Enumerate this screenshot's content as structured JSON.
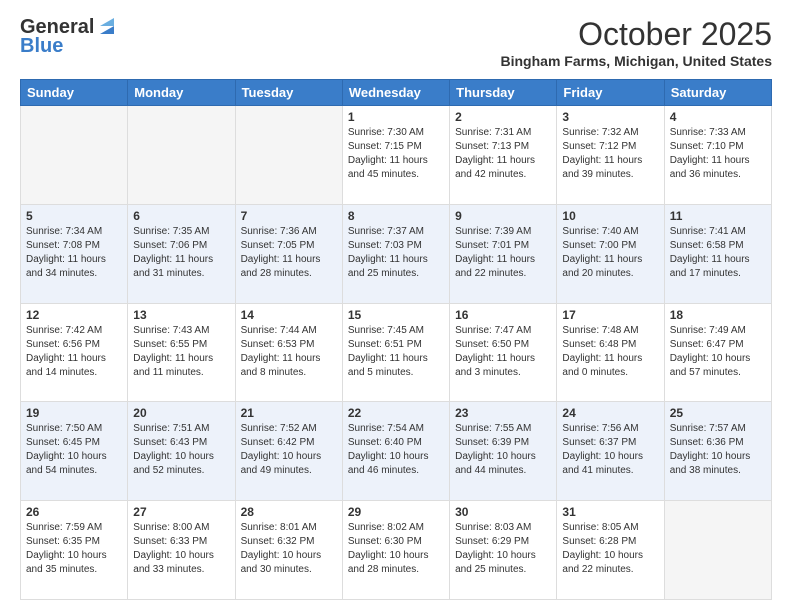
{
  "header": {
    "logo_line1": "General",
    "logo_line2": "Blue",
    "month": "October 2025",
    "location": "Bingham Farms, Michigan, United States"
  },
  "days_of_week": [
    "Sunday",
    "Monday",
    "Tuesday",
    "Wednesday",
    "Thursday",
    "Friday",
    "Saturday"
  ],
  "weeks": [
    [
      {
        "day": "",
        "info": ""
      },
      {
        "day": "",
        "info": ""
      },
      {
        "day": "",
        "info": ""
      },
      {
        "day": "1",
        "info": "Sunrise: 7:30 AM\nSunset: 7:15 PM\nDaylight: 11 hours\nand 45 minutes."
      },
      {
        "day": "2",
        "info": "Sunrise: 7:31 AM\nSunset: 7:13 PM\nDaylight: 11 hours\nand 42 minutes."
      },
      {
        "day": "3",
        "info": "Sunrise: 7:32 AM\nSunset: 7:12 PM\nDaylight: 11 hours\nand 39 minutes."
      },
      {
        "day": "4",
        "info": "Sunrise: 7:33 AM\nSunset: 7:10 PM\nDaylight: 11 hours\nand 36 minutes."
      }
    ],
    [
      {
        "day": "5",
        "info": "Sunrise: 7:34 AM\nSunset: 7:08 PM\nDaylight: 11 hours\nand 34 minutes."
      },
      {
        "day": "6",
        "info": "Sunrise: 7:35 AM\nSunset: 7:06 PM\nDaylight: 11 hours\nand 31 minutes."
      },
      {
        "day": "7",
        "info": "Sunrise: 7:36 AM\nSunset: 7:05 PM\nDaylight: 11 hours\nand 28 minutes."
      },
      {
        "day": "8",
        "info": "Sunrise: 7:37 AM\nSunset: 7:03 PM\nDaylight: 11 hours\nand 25 minutes."
      },
      {
        "day": "9",
        "info": "Sunrise: 7:39 AM\nSunset: 7:01 PM\nDaylight: 11 hours\nand 22 minutes."
      },
      {
        "day": "10",
        "info": "Sunrise: 7:40 AM\nSunset: 7:00 PM\nDaylight: 11 hours\nand 20 minutes."
      },
      {
        "day": "11",
        "info": "Sunrise: 7:41 AM\nSunset: 6:58 PM\nDaylight: 11 hours\nand 17 minutes."
      }
    ],
    [
      {
        "day": "12",
        "info": "Sunrise: 7:42 AM\nSunset: 6:56 PM\nDaylight: 11 hours\nand 14 minutes."
      },
      {
        "day": "13",
        "info": "Sunrise: 7:43 AM\nSunset: 6:55 PM\nDaylight: 11 hours\nand 11 minutes."
      },
      {
        "day": "14",
        "info": "Sunrise: 7:44 AM\nSunset: 6:53 PM\nDaylight: 11 hours\nand 8 minutes."
      },
      {
        "day": "15",
        "info": "Sunrise: 7:45 AM\nSunset: 6:51 PM\nDaylight: 11 hours\nand 5 minutes."
      },
      {
        "day": "16",
        "info": "Sunrise: 7:47 AM\nSunset: 6:50 PM\nDaylight: 11 hours\nand 3 minutes."
      },
      {
        "day": "17",
        "info": "Sunrise: 7:48 AM\nSunset: 6:48 PM\nDaylight: 11 hours\nand 0 minutes."
      },
      {
        "day": "18",
        "info": "Sunrise: 7:49 AM\nSunset: 6:47 PM\nDaylight: 10 hours\nand 57 minutes."
      }
    ],
    [
      {
        "day": "19",
        "info": "Sunrise: 7:50 AM\nSunset: 6:45 PM\nDaylight: 10 hours\nand 54 minutes."
      },
      {
        "day": "20",
        "info": "Sunrise: 7:51 AM\nSunset: 6:43 PM\nDaylight: 10 hours\nand 52 minutes."
      },
      {
        "day": "21",
        "info": "Sunrise: 7:52 AM\nSunset: 6:42 PM\nDaylight: 10 hours\nand 49 minutes."
      },
      {
        "day": "22",
        "info": "Sunrise: 7:54 AM\nSunset: 6:40 PM\nDaylight: 10 hours\nand 46 minutes."
      },
      {
        "day": "23",
        "info": "Sunrise: 7:55 AM\nSunset: 6:39 PM\nDaylight: 10 hours\nand 44 minutes."
      },
      {
        "day": "24",
        "info": "Sunrise: 7:56 AM\nSunset: 6:37 PM\nDaylight: 10 hours\nand 41 minutes."
      },
      {
        "day": "25",
        "info": "Sunrise: 7:57 AM\nSunset: 6:36 PM\nDaylight: 10 hours\nand 38 minutes."
      }
    ],
    [
      {
        "day": "26",
        "info": "Sunrise: 7:59 AM\nSunset: 6:35 PM\nDaylight: 10 hours\nand 35 minutes."
      },
      {
        "day": "27",
        "info": "Sunrise: 8:00 AM\nSunset: 6:33 PM\nDaylight: 10 hours\nand 33 minutes."
      },
      {
        "day": "28",
        "info": "Sunrise: 8:01 AM\nSunset: 6:32 PM\nDaylight: 10 hours\nand 30 minutes."
      },
      {
        "day": "29",
        "info": "Sunrise: 8:02 AM\nSunset: 6:30 PM\nDaylight: 10 hours\nand 28 minutes."
      },
      {
        "day": "30",
        "info": "Sunrise: 8:03 AM\nSunset: 6:29 PM\nDaylight: 10 hours\nand 25 minutes."
      },
      {
        "day": "31",
        "info": "Sunrise: 8:05 AM\nSunset: 6:28 PM\nDaylight: 10 hours\nand 22 minutes."
      },
      {
        "day": "",
        "info": ""
      }
    ]
  ]
}
